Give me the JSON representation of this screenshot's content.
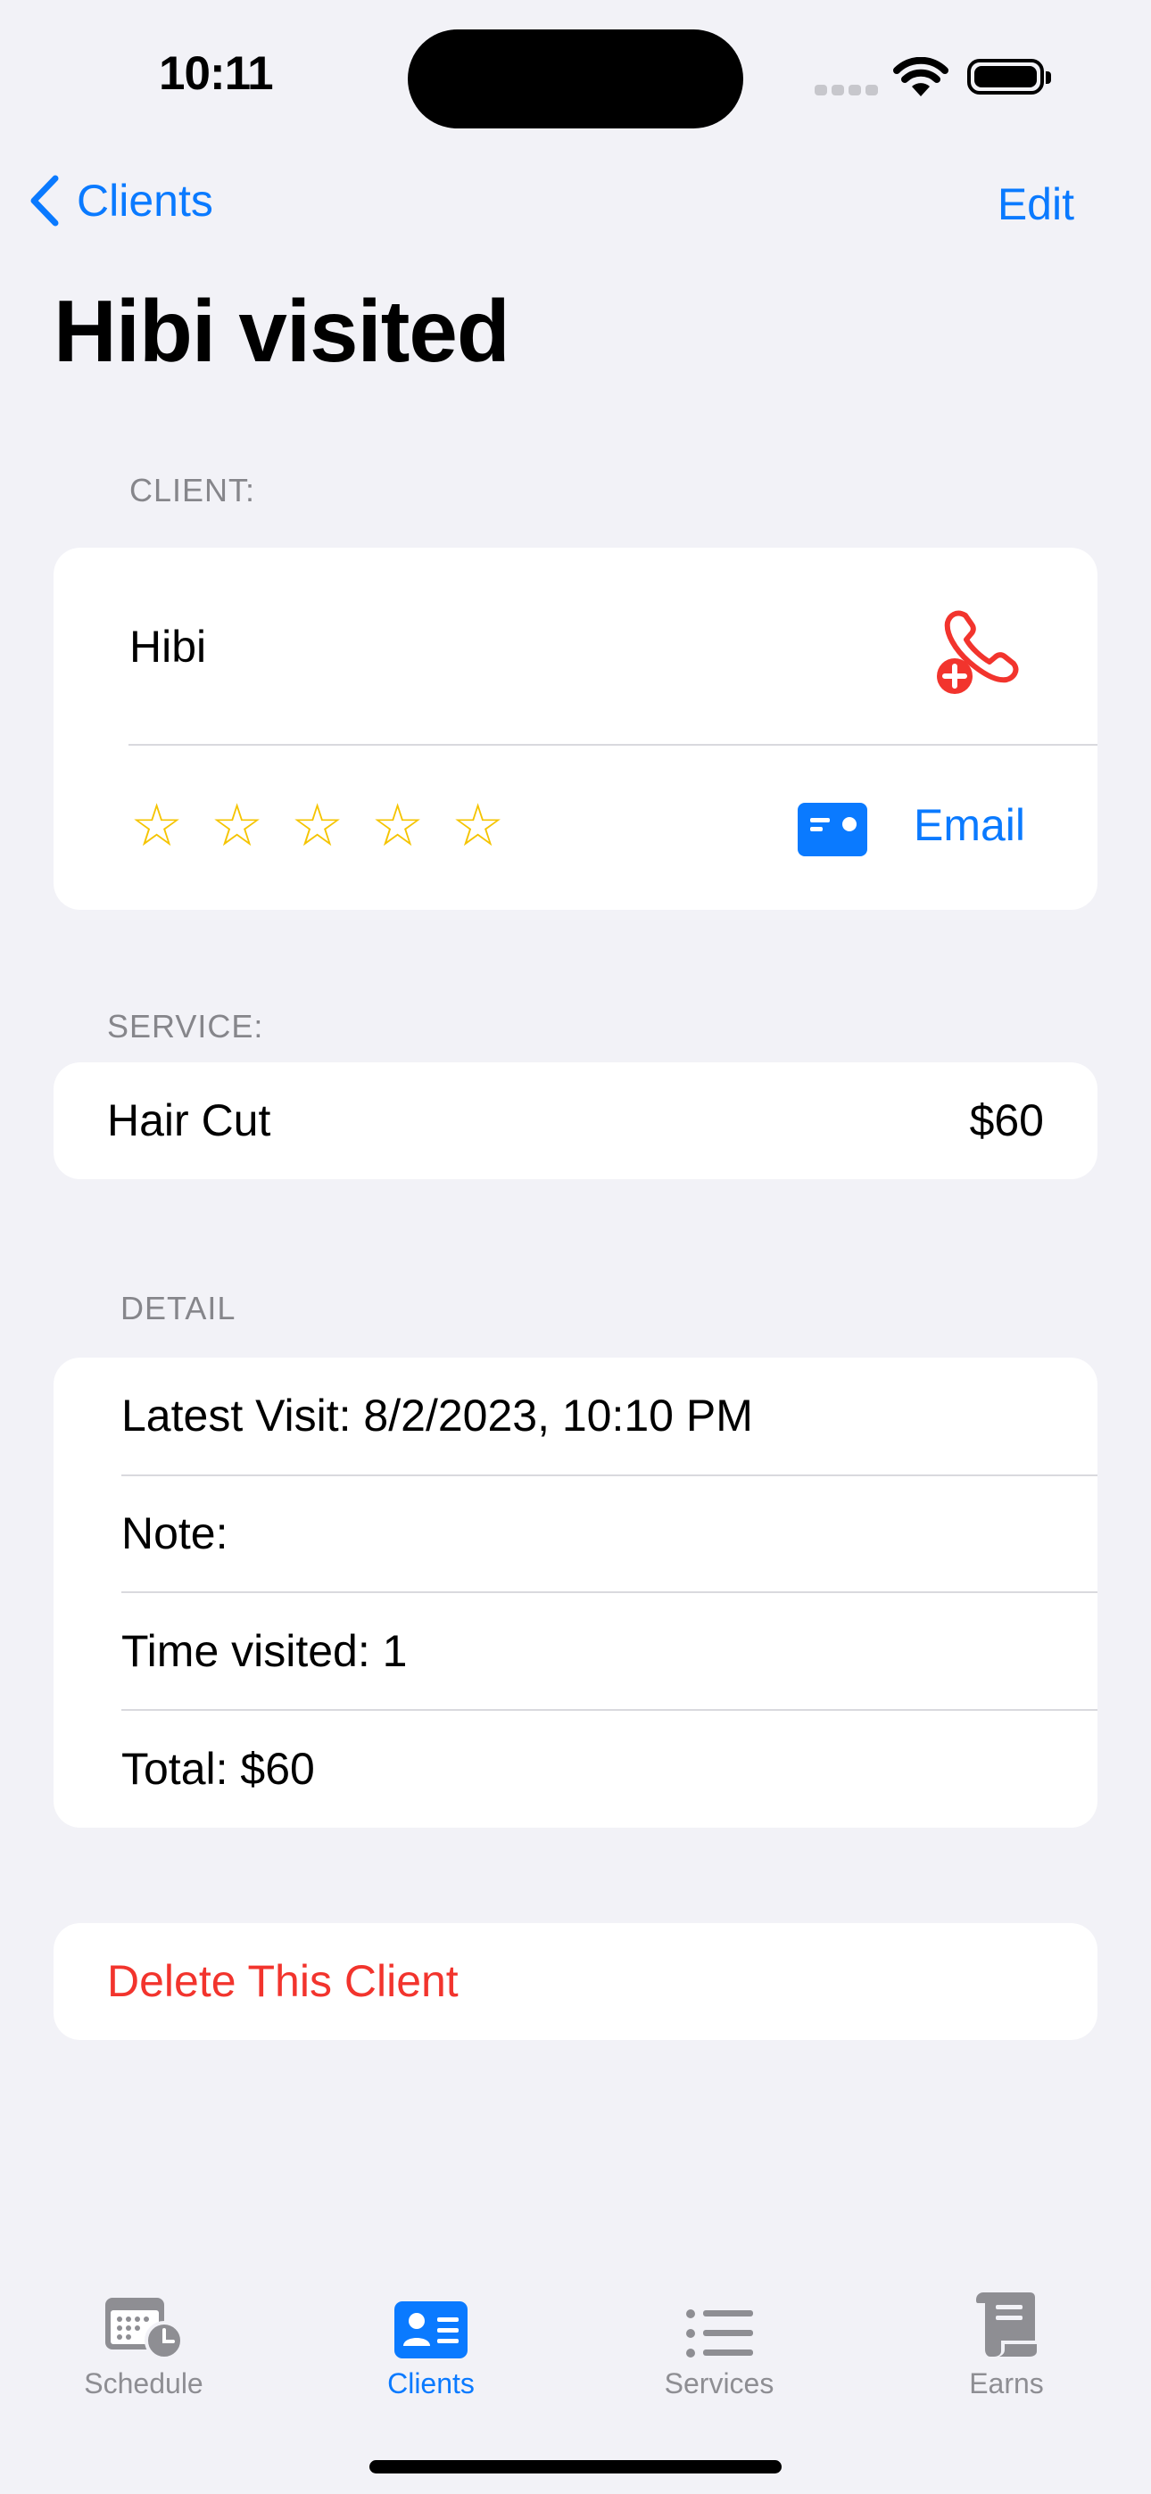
{
  "status_bar": {
    "time": "10:11"
  },
  "nav": {
    "back_label": "Clients",
    "edit_label": "Edit",
    "title": "Hibi visited"
  },
  "client_section": {
    "label": "CLIENT:",
    "name": "Hibi",
    "rating_stars": 5,
    "rating_filled": 0,
    "email_label": "Email",
    "call_icon": "phone-add-icon",
    "email_icon": "contact-card-icon"
  },
  "service_section": {
    "label": "SERVICE:",
    "name": "Hair Cut",
    "price": "$60"
  },
  "detail_section": {
    "label": "DETAIL",
    "rows": [
      "Latest Visit: 8/2/2023, 10:10 PM",
      "Note:",
      "Time visited: 1",
      "Total: $60"
    ]
  },
  "delete_label": "Delete This Client",
  "tabs": [
    {
      "label": "Schedule",
      "icon": "calendar-clock-icon",
      "active": false
    },
    {
      "label": "Clients",
      "icon": "person-card-icon",
      "active": true
    },
    {
      "label": "Services",
      "icon": "list-icon",
      "active": false
    },
    {
      "label": "Earns",
      "icon": "scroll-icon",
      "active": false
    }
  ],
  "colors": {
    "accent": "#0A7AFF",
    "destructive": "#F2342D",
    "star": "#F5C400",
    "background": "#F2F2F7"
  }
}
